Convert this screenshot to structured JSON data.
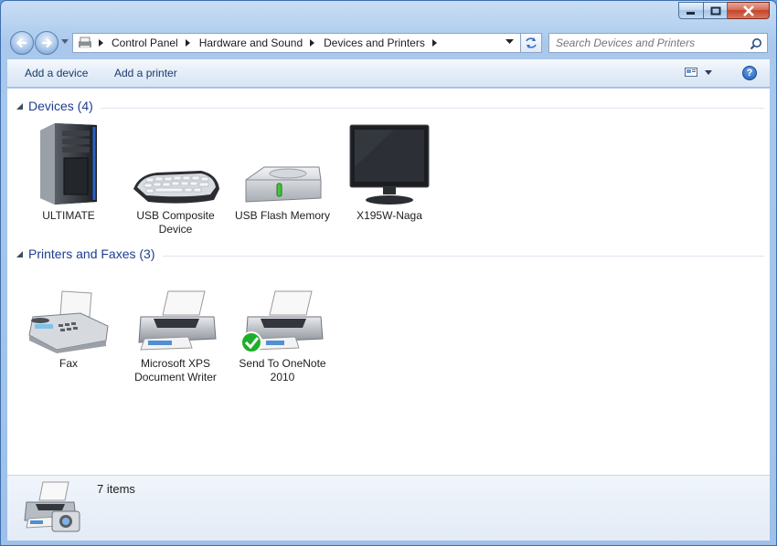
{
  "window": {
    "caption_buttons": [
      "minimize",
      "maximize",
      "close"
    ]
  },
  "address": {
    "crumbs": [
      "Control Panel",
      "Hardware and Sound",
      "Devices and Printers"
    ]
  },
  "search": {
    "placeholder": "Search Devices and Printers"
  },
  "toolbar": {
    "add_device": "Add a device",
    "add_printer": "Add a printer"
  },
  "groups": {
    "devices": {
      "title": "Devices (4)",
      "items": [
        {
          "label": "ULTIMATE",
          "icon": "computer-tower-icon"
        },
        {
          "label": "USB Composite Device",
          "icon": "keyboard-icon"
        },
        {
          "label": "USB Flash Memory",
          "icon": "usb-drive-icon"
        },
        {
          "label": "X195W-Naga",
          "icon": "monitor-icon"
        }
      ]
    },
    "printers": {
      "title": "Printers and Faxes (3)",
      "items": [
        {
          "label": "Fax",
          "icon": "fax-icon"
        },
        {
          "label": "Microsoft XPS Document Writer",
          "icon": "printer-icon"
        },
        {
          "label": "Send To OneNote 2010",
          "icon": "printer-default-icon"
        }
      ]
    }
  },
  "status": {
    "count": "7 items"
  },
  "colors": {
    "accent": "#1e3d8f",
    "frame": "#9fc0e8",
    "default_check": "#1fae2a"
  }
}
